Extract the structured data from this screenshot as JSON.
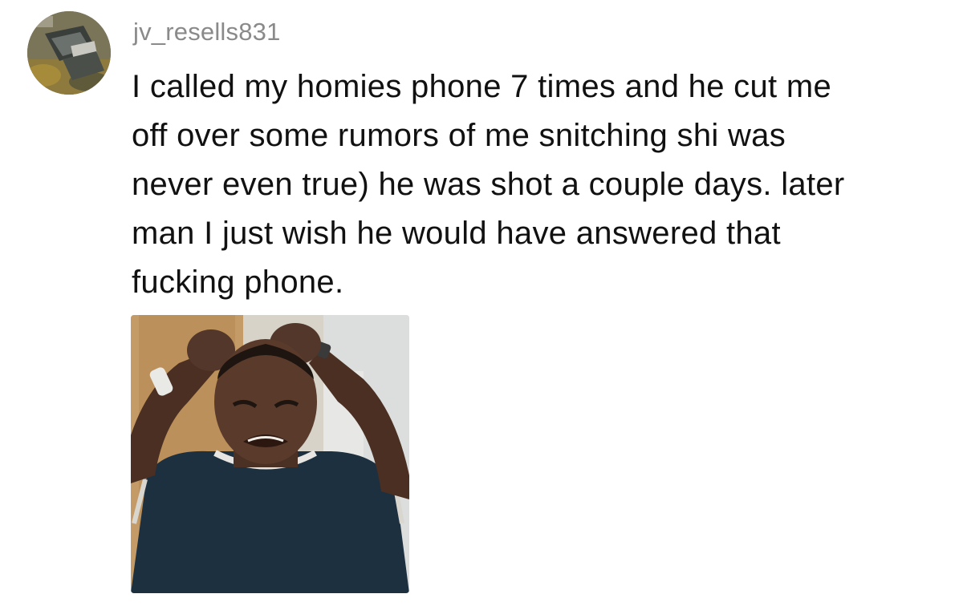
{
  "comment": {
    "avatar_icon": "user-avatar",
    "username": "jv_resells831",
    "text_lines": [
      "I called my homies phone 7 times and he cut me",
      "off over some rumors of me snitching shi was",
      "never even true) he was shot a couple days. later",
      "man I just wish he would have answered that",
      "fucking phone."
    ],
    "attachment_icon": "crying-man-gif"
  },
  "colors": {
    "background": "#ffffff",
    "username": "#8a8a8a",
    "text": "#111111"
  }
}
